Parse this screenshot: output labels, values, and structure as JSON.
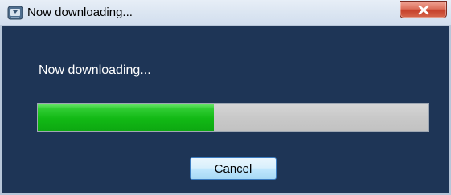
{
  "window": {
    "title": "Now downloading...",
    "icon": "download-app-icon",
    "close_icon": "close-icon"
  },
  "dialog": {
    "status_text": "Now downloading...",
    "progress_fraction": 0.45,
    "cancel_label": "Cancel"
  },
  "colors": {
    "dialog_background": "#1e3556",
    "progress_fill": "#12b915",
    "progress_track": "#c9c9c9",
    "close_button": "#c6412b"
  }
}
